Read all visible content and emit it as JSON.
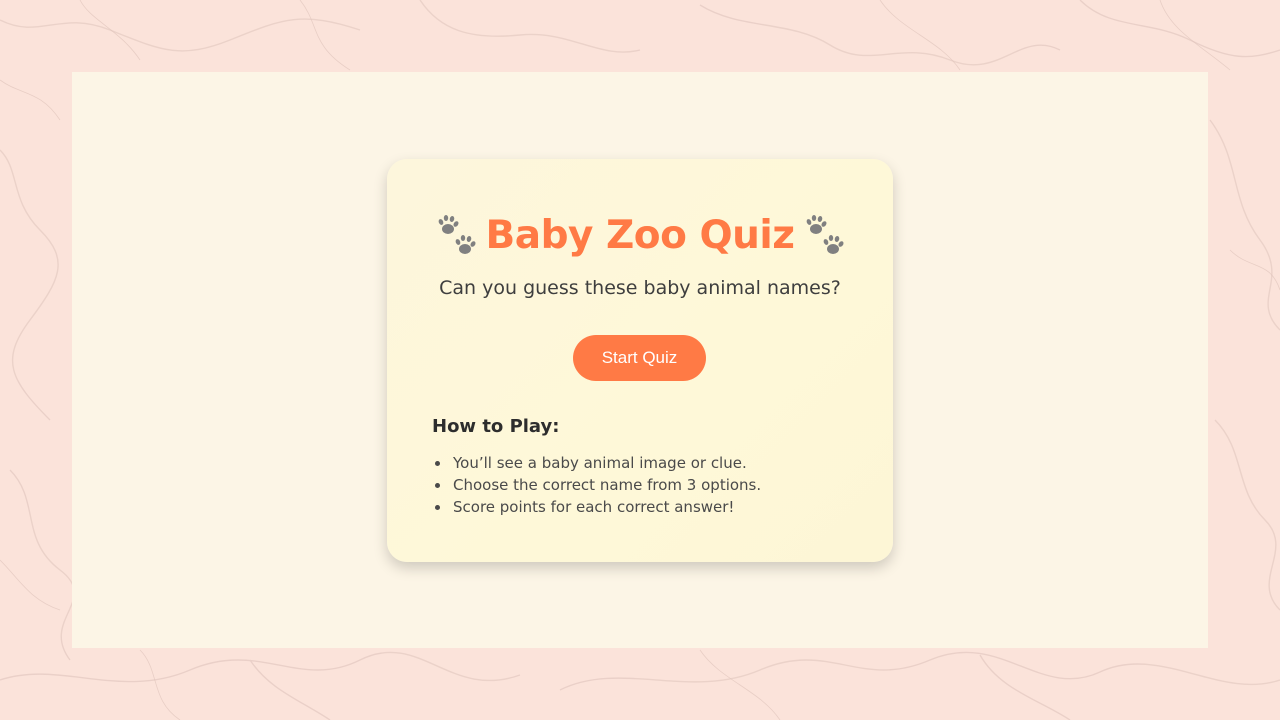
{
  "colors": {
    "page_background": "#fbe3da",
    "frame_background": "#fcf5e6",
    "card_background": "#fef8d8",
    "accent": "#ff7a45",
    "paw_icon": "#808080"
  },
  "quiz_card": {
    "title": "Baby Zoo Quiz",
    "title_icon_left": "paw-prints-icon",
    "title_icon_right": "paw-prints-icon",
    "subtitle": "Can you guess these baby animal names?",
    "start_button_label": "Start Quiz",
    "how_to_play": {
      "heading": "How to Play:",
      "items": [
        "You’ll see a baby animal image or clue.",
        "Choose the correct name from 3 options.",
        "Score points for each correct answer!"
      ]
    }
  }
}
